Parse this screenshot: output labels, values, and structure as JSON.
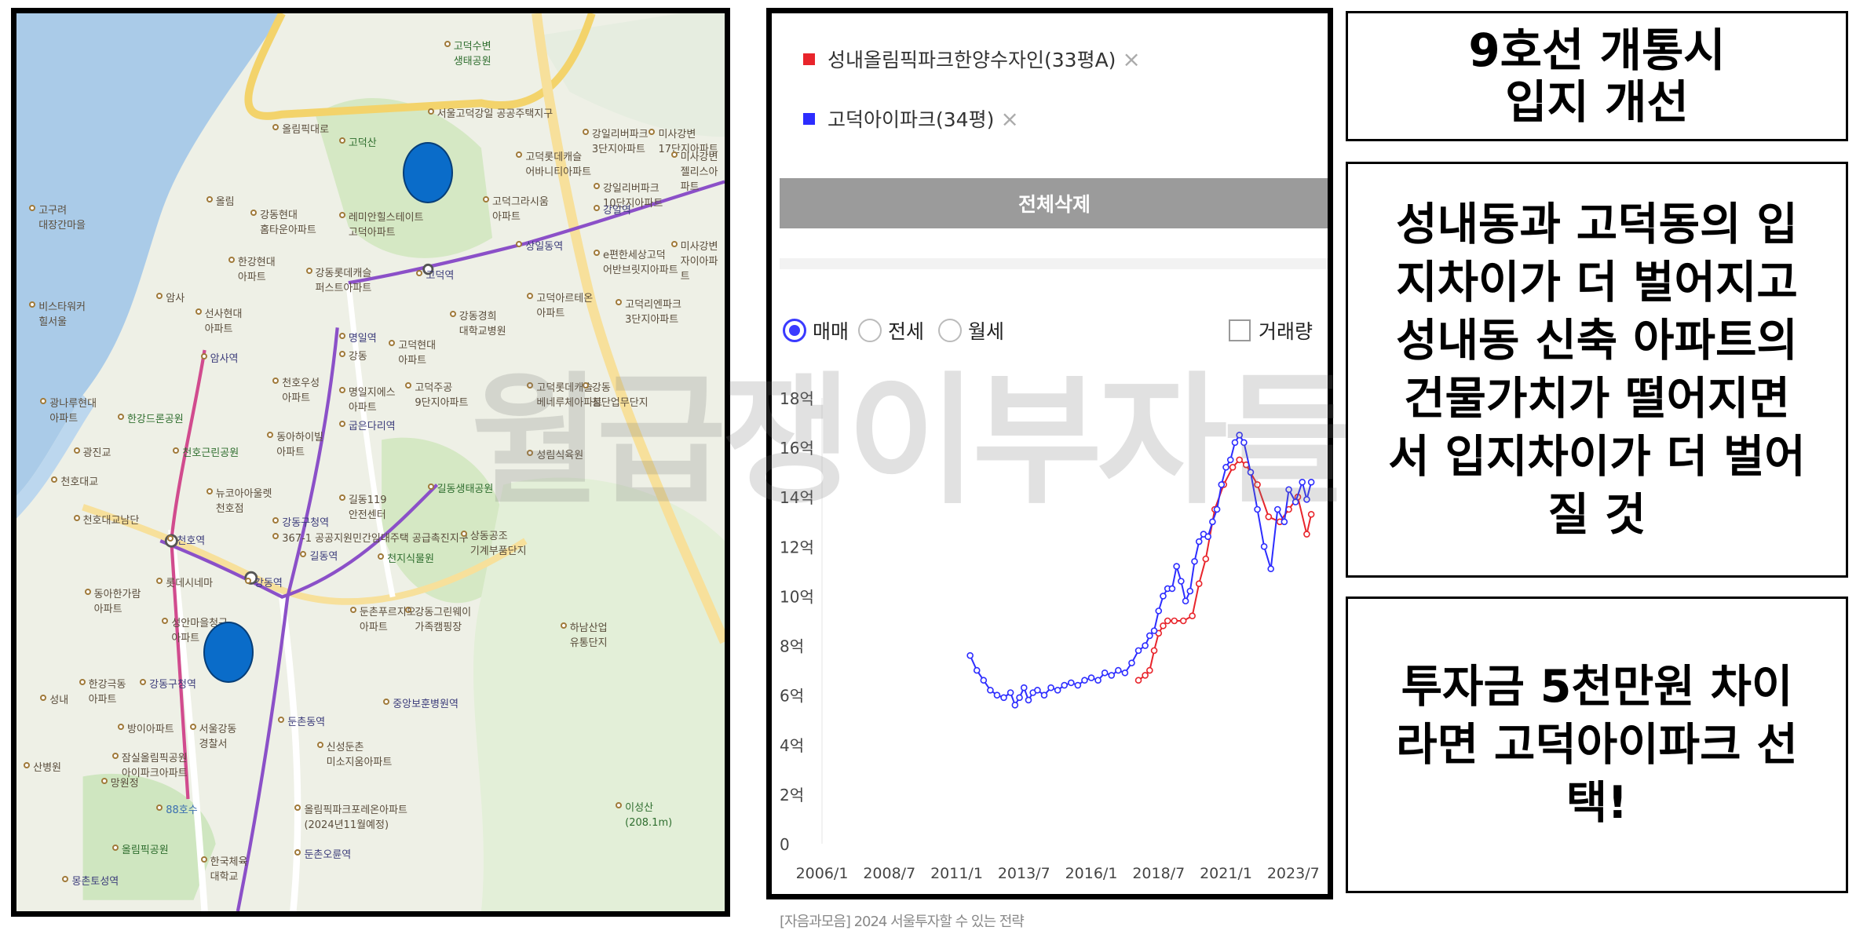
{
  "map": {
    "labels": [
      {
        "text": "고덕수변\n생태공원",
        "x": 395,
        "y": 22,
        "kind": "park"
      },
      {
        "text": "서울고덕강일 공공주택지구",
        "x": 380,
        "y": 82,
        "kind": "normal"
      },
      {
        "text": "올림픽대로",
        "x": 240,
        "y": 96,
        "kind": "normal"
      },
      {
        "text": "강일리버파크\n3단지아파트",
        "x": 520,
        "y": 100,
        "kind": "normal"
      },
      {
        "text": "미사강변\n17단지아파트",
        "x": 580,
        "y": 100,
        "kind": "normal"
      },
      {
        "text": "고덕산",
        "x": 300,
        "y": 108,
        "kind": "park"
      },
      {
        "text": "고덕롯데캐슬\n어바니티아파트",
        "x": 460,
        "y": 120,
        "kind": "normal"
      },
      {
        "text": "강일리버파크\n10단지아파트",
        "x": 530,
        "y": 148,
        "kind": "normal"
      },
      {
        "text": "미사강변\n젤리스아파트",
        "x": 600,
        "y": 120,
        "kind": "normal"
      },
      {
        "text": "올림",
        "x": 180,
        "y": 160,
        "kind": "normal"
      },
      {
        "text": "강동현대\n홈타운아파트",
        "x": 220,
        "y": 172,
        "kind": "normal"
      },
      {
        "text": "레미안힐스테이트\n고덕아파트",
        "x": 300,
        "y": 174,
        "kind": "normal"
      },
      {
        "text": "고덕그라시움\n아파트",
        "x": 430,
        "y": 160,
        "kind": "normal"
      },
      {
        "text": "강일역",
        "x": 530,
        "y": 168,
        "kind": "station"
      },
      {
        "text": "고구려\n대장간마을",
        "x": 20,
        "y": 168,
        "kind": "normal"
      },
      {
        "text": "상일동역",
        "x": 460,
        "y": 200,
        "kind": "station"
      },
      {
        "text": "e편한세상고덕\n어반브릿지아파트",
        "x": 530,
        "y": 208,
        "kind": "normal"
      },
      {
        "text": "미사강변\n자이아파트",
        "x": 600,
        "y": 200,
        "kind": "normal"
      },
      {
        "text": "한강현대\n아파트",
        "x": 200,
        "y": 214,
        "kind": "normal"
      },
      {
        "text": "강동롯데캐슬\n퍼스트아파트",
        "x": 270,
        "y": 224,
        "kind": "normal"
      },
      {
        "text": "고덕역",
        "x": 370,
        "y": 226,
        "kind": "station"
      },
      {
        "text": "고덕아르테온\n아파트",
        "x": 470,
        "y": 246,
        "kind": "normal"
      },
      {
        "text": "고덕리엔파크\n3단지아파트",
        "x": 550,
        "y": 252,
        "kind": "normal"
      },
      {
        "text": "강동경희\n대학교병원",
        "x": 400,
        "y": 262,
        "kind": "normal"
      },
      {
        "text": "비스타워커\n힐서울",
        "x": 20,
        "y": 254,
        "kind": "normal"
      },
      {
        "text": "암사",
        "x": 135,
        "y": 246,
        "kind": "normal"
      },
      {
        "text": "선사현대\n아파트",
        "x": 170,
        "y": 260,
        "kind": "normal"
      },
      {
        "text": "명일역",
        "x": 300,
        "y": 282,
        "kind": "station"
      },
      {
        "text": "고덕현대\n아파트",
        "x": 345,
        "y": 288,
        "kind": "normal"
      },
      {
        "text": "암사역",
        "x": 175,
        "y": 300,
        "kind": "station"
      },
      {
        "text": "강동",
        "x": 300,
        "y": 298,
        "kind": "normal"
      },
      {
        "text": "천호우성\n아파트",
        "x": 240,
        "y": 322,
        "kind": "normal"
      },
      {
        "text": "명일지에스\n아파트",
        "x": 300,
        "y": 330,
        "kind": "normal"
      },
      {
        "text": "고덕주공\n9단지아파트",
        "x": 360,
        "y": 326,
        "kind": "normal"
      },
      {
        "text": "고덕롯데캐슬\n베네루체아파트",
        "x": 470,
        "y": 326,
        "kind": "normal"
      },
      {
        "text": "강동\n첨단업무단지",
        "x": 520,
        "y": 326,
        "kind": "normal"
      },
      {
        "text": "광나루현대\n아파트",
        "x": 30,
        "y": 340,
        "kind": "normal"
      },
      {
        "text": "한강드론공원",
        "x": 100,
        "y": 354,
        "kind": "park"
      },
      {
        "text": "굽은다리역",
        "x": 300,
        "y": 360,
        "kind": "station"
      },
      {
        "text": "동아하이빌\n아파트",
        "x": 235,
        "y": 370,
        "kind": "normal"
      },
      {
        "text": "천호근린공원",
        "x": 150,
        "y": 384,
        "kind": "park"
      },
      {
        "text": "성림식육원",
        "x": 470,
        "y": 386,
        "kind": "normal"
      },
      {
        "text": "광진교",
        "x": 60,
        "y": 384,
        "kind": "normal"
      },
      {
        "text": "천호대교",
        "x": 40,
        "y": 410,
        "kind": "normal"
      },
      {
        "text": "뉴코아아울렛\n천호점",
        "x": 180,
        "y": 420,
        "kind": "normal"
      },
      {
        "text": "길동생태공원",
        "x": 380,
        "y": 416,
        "kind": "park"
      },
      {
        "text": "길동119\n안전센터",
        "x": 300,
        "y": 426,
        "kind": "normal"
      },
      {
        "text": "천호대교남단",
        "x": 60,
        "y": 444,
        "kind": "normal"
      },
      {
        "text": "강동구청역",
        "x": 240,
        "y": 446,
        "kind": "station"
      },
      {
        "text": "367-1 공공지원민간임대주택 공급촉진지구",
        "x": 240,
        "y": 460,
        "kind": "normal"
      },
      {
        "text": "상동공조\n기계부품단지",
        "x": 410,
        "y": 458,
        "kind": "normal"
      },
      {
        "text": "천호역",
        "x": 145,
        "y": 462,
        "kind": "station"
      },
      {
        "text": "길동역",
        "x": 265,
        "y": 476,
        "kind": "station"
      },
      {
        "text": "천지식물원",
        "x": 335,
        "y": 478,
        "kind": "park"
      },
      {
        "text": "롯데시네마",
        "x": 135,
        "y": 500,
        "kind": "normal"
      },
      {
        "text": "동아한가람\n아파트",
        "x": 70,
        "y": 510,
        "kind": "normal"
      },
      {
        "text": "강동역",
        "x": 215,
        "y": 500,
        "kind": "station"
      },
      {
        "text": "강동그린웨이\n가족캠핑장",
        "x": 360,
        "y": 526,
        "kind": "normal"
      },
      {
        "text": "성안마을청구\n아파트",
        "x": 140,
        "y": 536,
        "kind": "normal"
      },
      {
        "text": "둔촌푸르지오\n아파트",
        "x": 310,
        "y": 526,
        "kind": "normal"
      },
      {
        "text": "하남산업\n유통단지",
        "x": 500,
        "y": 540,
        "kind": "normal"
      },
      {
        "text": "한강극동\n아파트",
        "x": 65,
        "y": 590,
        "kind": "normal"
      },
      {
        "text": "강동구청역",
        "x": 120,
        "y": 590,
        "kind": "station"
      },
      {
        "text": "중앙보훈병원역",
        "x": 340,
        "y": 608,
        "kind": "station"
      },
      {
        "text": "둔촌동역",
        "x": 245,
        "y": 624,
        "kind": "station"
      },
      {
        "text": "성내",
        "x": 30,
        "y": 604,
        "kind": "normal"
      },
      {
        "text": "방이아파트",
        "x": 100,
        "y": 630,
        "kind": "normal"
      },
      {
        "text": "서울강동\n경찰서",
        "x": 165,
        "y": 630,
        "kind": "normal"
      },
      {
        "text": "신성둔촌\n미소지움아파트",
        "x": 280,
        "y": 646,
        "kind": "normal"
      },
      {
        "text": "잠실올림픽공원\n아이파크아파트",
        "x": 95,
        "y": 656,
        "kind": "normal"
      },
      {
        "text": "산병원",
        "x": 15,
        "y": 664,
        "kind": "normal"
      },
      {
        "text": "이성산\n(208.1m)",
        "x": 550,
        "y": 700,
        "kind": "park"
      },
      {
        "text": "올림픽파크포레온아파트\n(2024년11월예정)",
        "x": 260,
        "y": 702,
        "kind": "normal"
      },
      {
        "text": "망원정",
        "x": 85,
        "y": 678,
        "kind": "normal"
      },
      {
        "text": "88호수",
        "x": 135,
        "y": 702,
        "kind": "river"
      },
      {
        "text": "올림픽공원",
        "x": 95,
        "y": 738,
        "kind": "park"
      },
      {
        "text": "둔촌오륜역",
        "x": 260,
        "y": 742,
        "kind": "station"
      },
      {
        "text": "한국체육\n대학교",
        "x": 175,
        "y": 748,
        "kind": "normal"
      },
      {
        "text": "몽촌토성역",
        "x": 50,
        "y": 766,
        "kind": "station"
      }
    ],
    "markers": [
      {
        "name": "marker-gangdong-bottom"
      },
      {
        "name": "marker-godeok-top"
      }
    ]
  },
  "chart_panel": {
    "legend": [
      {
        "label": "성내올림픽파크한양수자인(33평A)",
        "color": "#e8242b",
        "close": "×"
      },
      {
        "label": "고덕아이파크(34평)",
        "color": "#2d2dff",
        "close": "×"
      }
    ],
    "delete_all_label": "전체삭제",
    "radio_options": [
      {
        "label": "매매",
        "checked": true
      },
      {
        "label": "전세",
        "checked": false
      },
      {
        "label": "월세",
        "checked": false
      }
    ],
    "volume_label": "거래량",
    "watermark": "월급쟁이부자들",
    "source_caption": "[자음과모음] 2024 서울투자할 수 있는 전략"
  },
  "chart_data": {
    "type": "line",
    "title": "",
    "xlabel": "",
    "ylabel": "",
    "x_ticks": [
      "2006/1",
      "2008/7",
      "2011/1",
      "2013/7",
      "2016/1",
      "2018/7",
      "2021/1",
      "2023/7"
    ],
    "y_ticks": [
      "0",
      "2억",
      "4억",
      "6억",
      "8억",
      "10억",
      "12억",
      "14억",
      "16억",
      "18억"
    ],
    "ylim": [
      0,
      18
    ],
    "xlim": [
      "2006-01",
      "2024-04"
    ],
    "grid": false,
    "series": [
      {
        "name": "성내올림픽파크한양수자인(33평A)",
        "color": "#e8242b",
        "points": [
          [
            "2017-10",
            6.6
          ],
          [
            "2018-01",
            6.8
          ],
          [
            "2018-03",
            7.0
          ],
          [
            "2018-05",
            7.8
          ],
          [
            "2018-07",
            8.5
          ],
          [
            "2018-09",
            8.8
          ],
          [
            "2018-11",
            9.0
          ],
          [
            "2019-02",
            9.0
          ],
          [
            "2019-06",
            9.0
          ],
          [
            "2019-10",
            9.2
          ],
          [
            "2020-01",
            10.5
          ],
          [
            "2020-04",
            11.5
          ],
          [
            "2020-08",
            13.5
          ],
          [
            "2020-12",
            14.5
          ],
          [
            "2021-04",
            15.2
          ],
          [
            "2021-07",
            15.5
          ],
          [
            "2021-10",
            15.3
          ],
          [
            "2022-03",
            14.5
          ],
          [
            "2022-08",
            13.2
          ],
          [
            "2023-01",
            13.0
          ],
          [
            "2023-05",
            13.5
          ],
          [
            "2023-09",
            14.0
          ],
          [
            "2024-01",
            12.5
          ],
          [
            "2024-03",
            13.3
          ]
        ]
      },
      {
        "name": "고덕아이파크(34평)",
        "color": "#2d2dff",
        "points": [
          [
            "2011-07",
            7.6
          ],
          [
            "2011-10",
            7.0
          ],
          [
            "2012-01",
            6.6
          ],
          [
            "2012-04",
            6.2
          ],
          [
            "2012-07",
            6.0
          ],
          [
            "2012-10",
            5.9
          ],
          [
            "2013-01",
            6.1
          ],
          [
            "2013-03",
            5.6
          ],
          [
            "2013-05",
            5.9
          ],
          [
            "2013-07",
            6.3
          ],
          [
            "2013-09",
            5.8
          ],
          [
            "2013-11",
            6.1
          ],
          [
            "2014-01",
            6.2
          ],
          [
            "2014-04",
            6.0
          ],
          [
            "2014-07",
            6.3
          ],
          [
            "2014-10",
            6.2
          ],
          [
            "2015-01",
            6.4
          ],
          [
            "2015-04",
            6.5
          ],
          [
            "2015-07",
            6.4
          ],
          [
            "2015-10",
            6.6
          ],
          [
            "2016-01",
            6.7
          ],
          [
            "2016-04",
            6.6
          ],
          [
            "2016-07",
            6.9
          ],
          [
            "2016-10",
            6.8
          ],
          [
            "2017-01",
            7.0
          ],
          [
            "2017-04",
            6.9
          ],
          [
            "2017-07",
            7.3
          ],
          [
            "2017-10",
            7.8
          ],
          [
            "2018-01",
            8.0
          ],
          [
            "2018-03",
            8.4
          ],
          [
            "2018-05",
            8.6
          ],
          [
            "2018-07",
            9.4
          ],
          [
            "2018-09",
            10.0
          ],
          [
            "2018-11",
            10.3
          ],
          [
            "2019-01",
            10.3
          ],
          [
            "2019-03",
            11.2
          ],
          [
            "2019-05",
            10.6
          ],
          [
            "2019-07",
            9.8
          ],
          [
            "2019-09",
            10.2
          ],
          [
            "2019-11",
            11.4
          ],
          [
            "2020-01",
            12.2
          ],
          [
            "2020-03",
            12.5
          ],
          [
            "2020-05",
            12.4
          ],
          [
            "2020-07",
            13.0
          ],
          [
            "2020-09",
            13.5
          ],
          [
            "2020-11",
            14.5
          ],
          [
            "2021-01",
            15.2
          ],
          [
            "2021-03",
            15.5
          ],
          [
            "2021-05",
            16.2
          ],
          [
            "2021-07",
            16.5
          ],
          [
            "2021-09",
            16.2
          ],
          [
            "2021-12",
            15.0
          ],
          [
            "2022-03",
            13.5
          ],
          [
            "2022-06",
            12.0
          ],
          [
            "2022-09",
            11.1
          ],
          [
            "2022-12",
            13.5
          ],
          [
            "2023-03",
            13.0
          ],
          [
            "2023-05",
            14.3
          ],
          [
            "2023-08",
            13.8
          ],
          [
            "2023-11",
            14.6
          ],
          [
            "2024-01",
            13.9
          ],
          [
            "2024-03",
            14.6
          ]
        ]
      }
    ]
  },
  "text_boxes": {
    "box1": "9호선 개통시\n입지 개선",
    "box2": "성내동과 고덕동의 입\n지차이가 더 벌어지고\n성내동 신축 아파트의\n건물가치가 떨어지면\n서 입지차이가 더 벌어\n질 것",
    "box3": "투자금 5천만원 차이\n라면 고덕아이파크 선\n택!"
  }
}
